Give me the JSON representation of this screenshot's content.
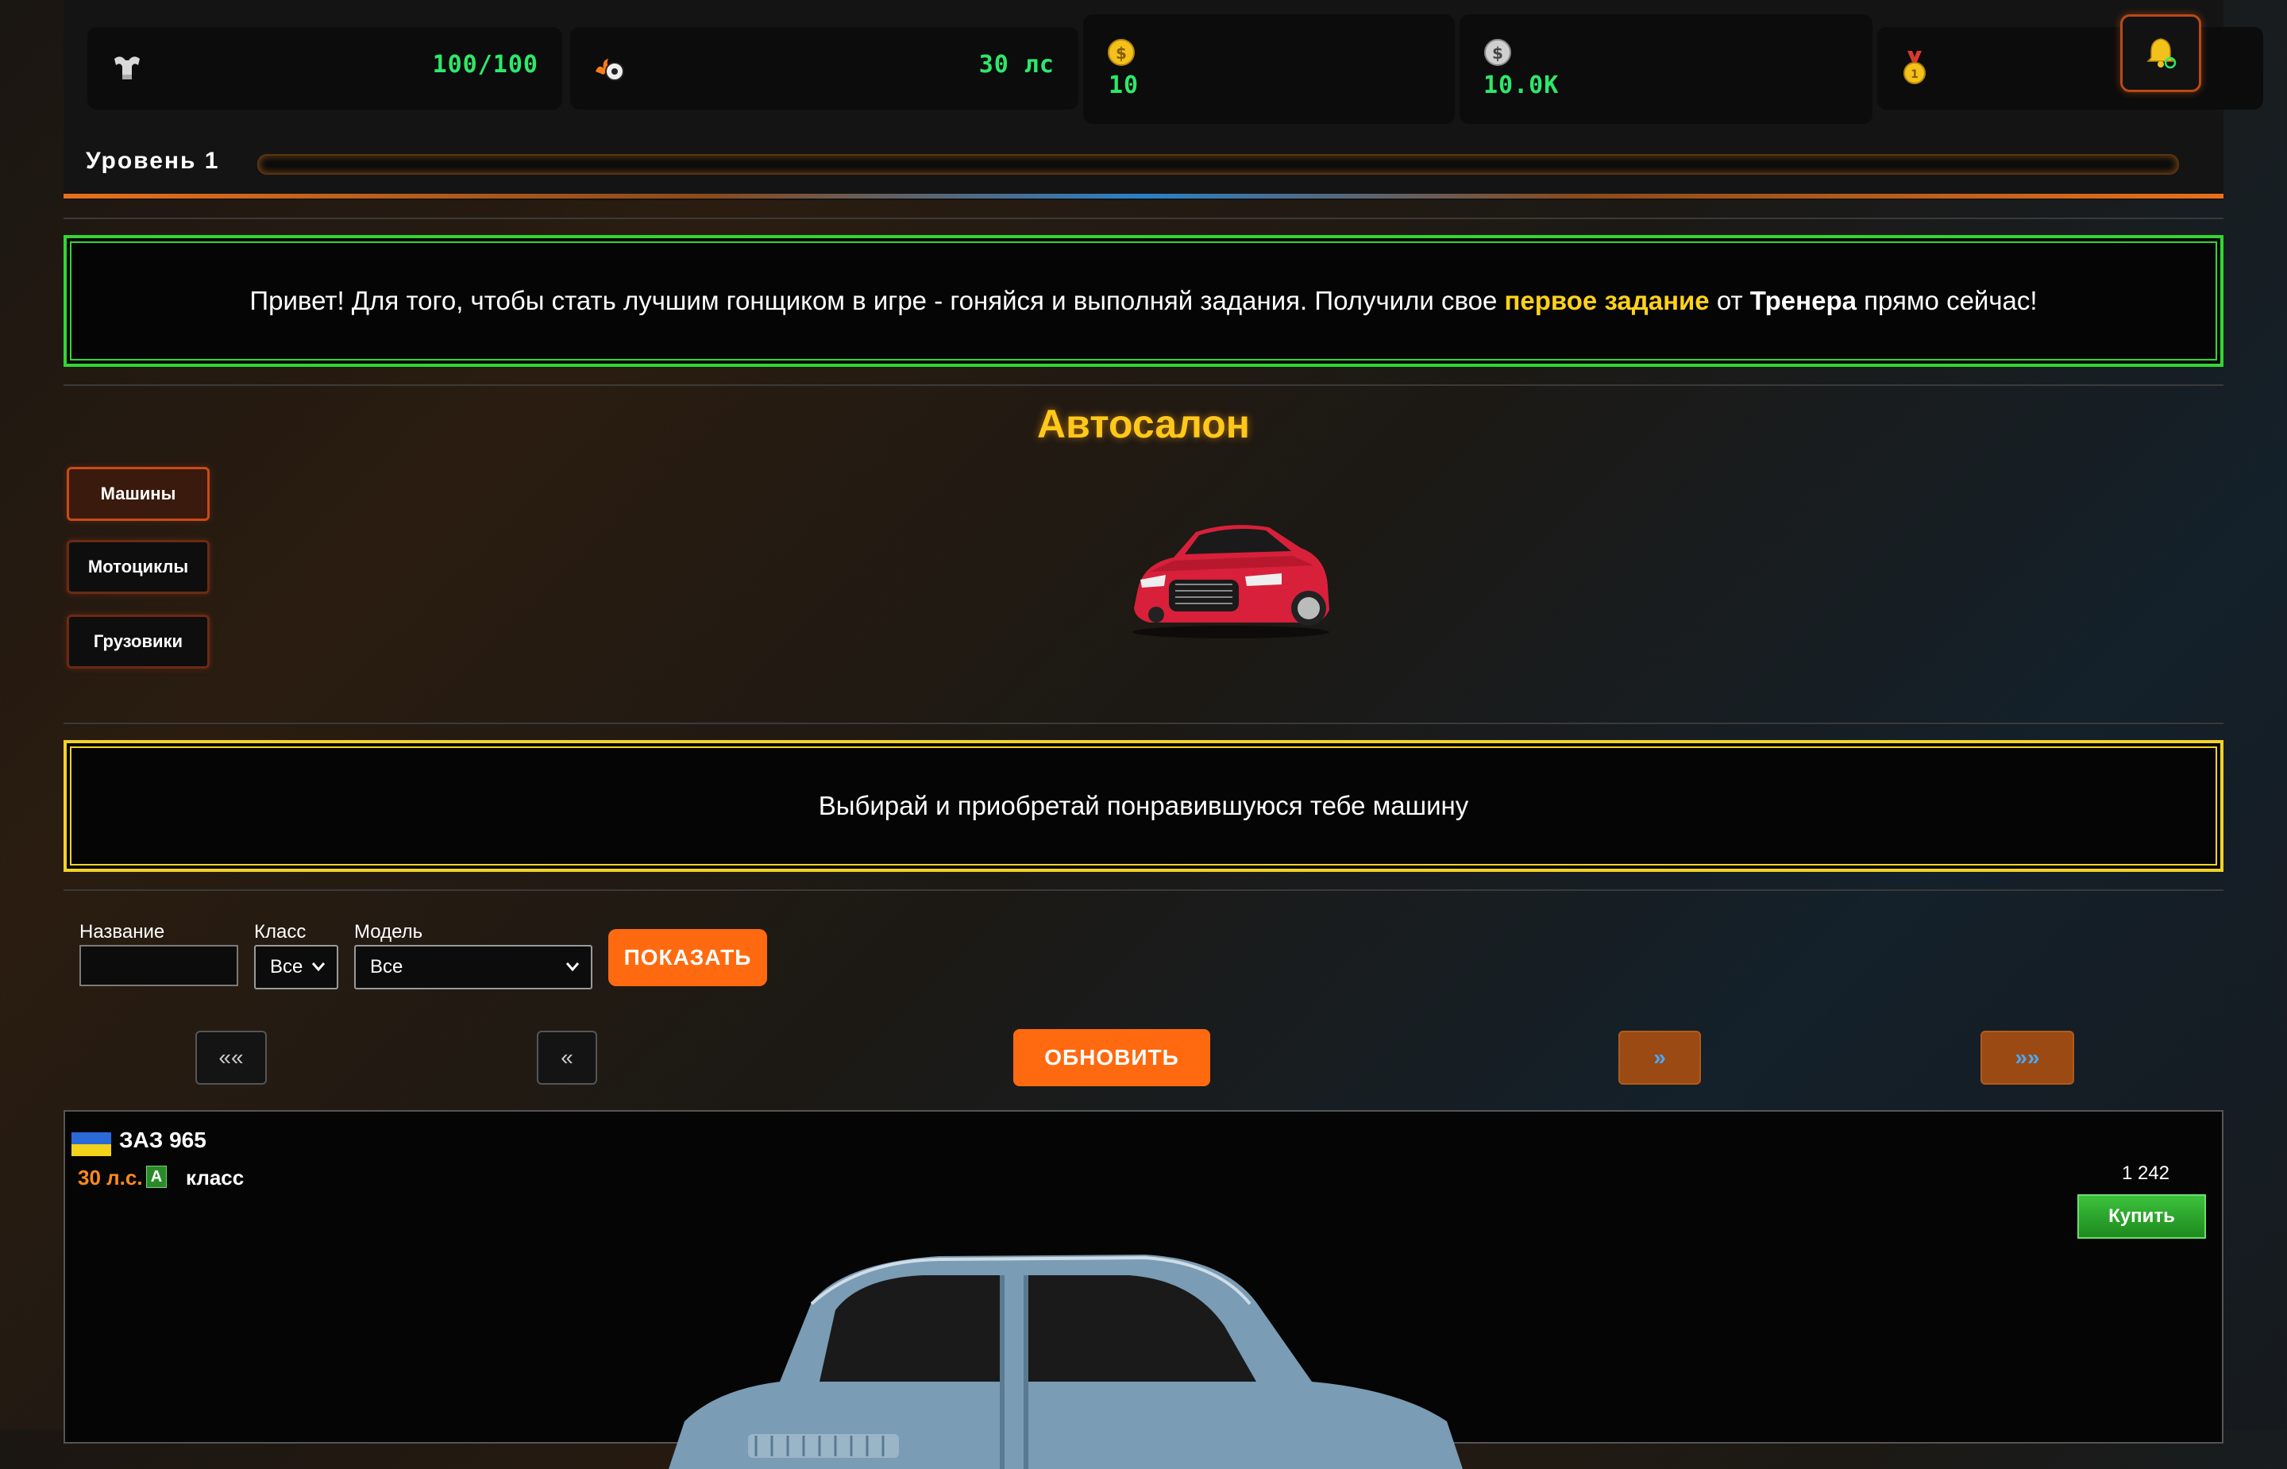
{
  "stats": {
    "energy": {
      "icon": "muscle-icon",
      "value": "100/100"
    },
    "power": {
      "icon": "wheel-fire-icon",
      "value": "30 лс"
    },
    "gold": {
      "icon": "gold-coin-icon",
      "value": "10"
    },
    "silver": {
      "icon": "silver-coin-icon",
      "value": "10.0K"
    },
    "medal": {
      "icon": "medal-icon"
    }
  },
  "level": {
    "label": "Уровень 1",
    "progress": 0.0
  },
  "notifications": {
    "icon": "bell-icon"
  },
  "intro_notice": {
    "part1": "Привет! Для того, чтобы стать лучшим гонщиком в игре - гоняйся и выполняй задания. Получили свое ",
    "highlight1": "первое задание",
    "part2": " от ",
    "highlight2": "Тренера",
    "part3": " прямо сейчас!"
  },
  "salon": {
    "title": "Автосалон",
    "tabs": [
      {
        "label": "Машины",
        "active": true
      },
      {
        "label": "Мотоциклы",
        "active": false
      },
      {
        "label": "Грузовики",
        "active": false
      }
    ]
  },
  "choose_notice": "Выбирай и приобретай понравившуюся тебе машину",
  "filters": {
    "name_label": "Название",
    "name_value": "",
    "class_label": "Класс",
    "class_value": "Все",
    "model_label": "Модель",
    "model_value": "Все",
    "show_button": "ПОКАЗАТЬ"
  },
  "pagination": {
    "first": "««",
    "prev": "«",
    "refresh": "ОБНОВИТЬ",
    "next": "»",
    "last": "»»"
  },
  "vehicle": {
    "name": "ЗАЗ 965",
    "power": "30 л.с.",
    "class_badge": "А",
    "class_word": "класс",
    "price": "1 242",
    "buy_button": "Купить",
    "flag": "ukraine-flag-icon"
  },
  "colors": {
    "accent_orange": "#ff6a10",
    "stat_green": "#2ee86a",
    "title_yellow": "#ffc81a",
    "notice_green": "#33d633",
    "notice_yellow": "#f2d22a"
  }
}
